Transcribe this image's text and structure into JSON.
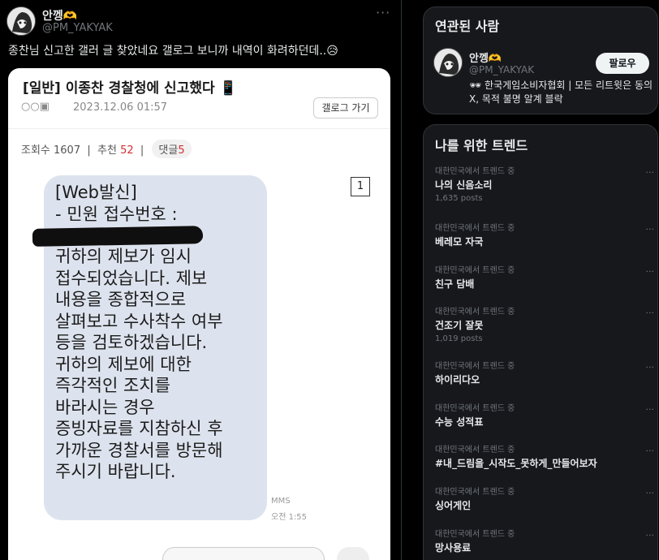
{
  "tweet": {
    "name": "안껭🫶",
    "handle": "@PM_YAKYAK",
    "more": "···",
    "text": "종찬님 신고한 갤러 글 찾았네요 갤로그 보니까 내역이 화려하던데..😥"
  },
  "image": {
    "post_title": "[일반] 이종찬 경찰청에 신고했다 📱",
    "meta_icons": "○○▣",
    "date": "2023.12.06 01:57",
    "gallery_button": "갤로그 가기",
    "views_label": "조회수 1607",
    "recommend_label": "추천",
    "recommend_value": "52",
    "comment_label": "댓글",
    "comment_value": "5",
    "mms_lines": [
      "[Web발신]",
      "- 민원 접수번호 :",
      " ",
      "귀하의 제보가 임시",
      "접수되었습니다. 제보",
      "내용을 종합적으로",
      "살펴보고 수사착수 여부",
      "등을 검토하겠습니다.",
      "귀하의 제보에 대한",
      "즉각적인 조치를",
      "바라시는 경우",
      "증빙자료를 지참하신 후",
      "가까운 경찰서를 방문해",
      "주시기 바랍니다."
    ],
    "mms_label": "MMS",
    "mms_time": "오전 1:55",
    "count": "1"
  },
  "related": {
    "title": "연관된 사람",
    "name": "안껭🫶",
    "handle": "@PM_YAKYAK",
    "follow": "팔로우",
    "bio": "🕶 한국게임소비자협회 | 모든 리트윗은 동의 X, 목적 불명 알계 블락"
  },
  "trends": {
    "title": "나를 위한 트렌드",
    "items": [
      {
        "context": "대한민국에서 트렌드 중",
        "name": "나의 신음소리",
        "posts": "1,635 posts"
      },
      {
        "context": "대한민국에서 트렌드 중",
        "name": "베레모 자국",
        "posts": ""
      },
      {
        "context": "대한민국에서 트렌드 중",
        "name": "친구 담배",
        "posts": ""
      },
      {
        "context": "대한민국에서 트렌드 중",
        "name": "건조기 잘못",
        "posts": "1,019 posts"
      },
      {
        "context": "대한민국에서 트렌드 중",
        "name": "하이리다오",
        "posts": ""
      },
      {
        "context": "대한민국에서 트렌드 중",
        "name": "수능 성적표",
        "posts": ""
      },
      {
        "context": "대한민국에서 트렌드 중",
        "name": "#내_드림을_시작도_못하게_만들어보자",
        "posts": ""
      },
      {
        "context": "대한민국에서 트렌드 중",
        "name": "싱어게인",
        "posts": ""
      },
      {
        "context": "대한민국에서 트렌드 중",
        "name": "망사용료",
        "posts": ""
      }
    ],
    "more": "···"
  }
}
